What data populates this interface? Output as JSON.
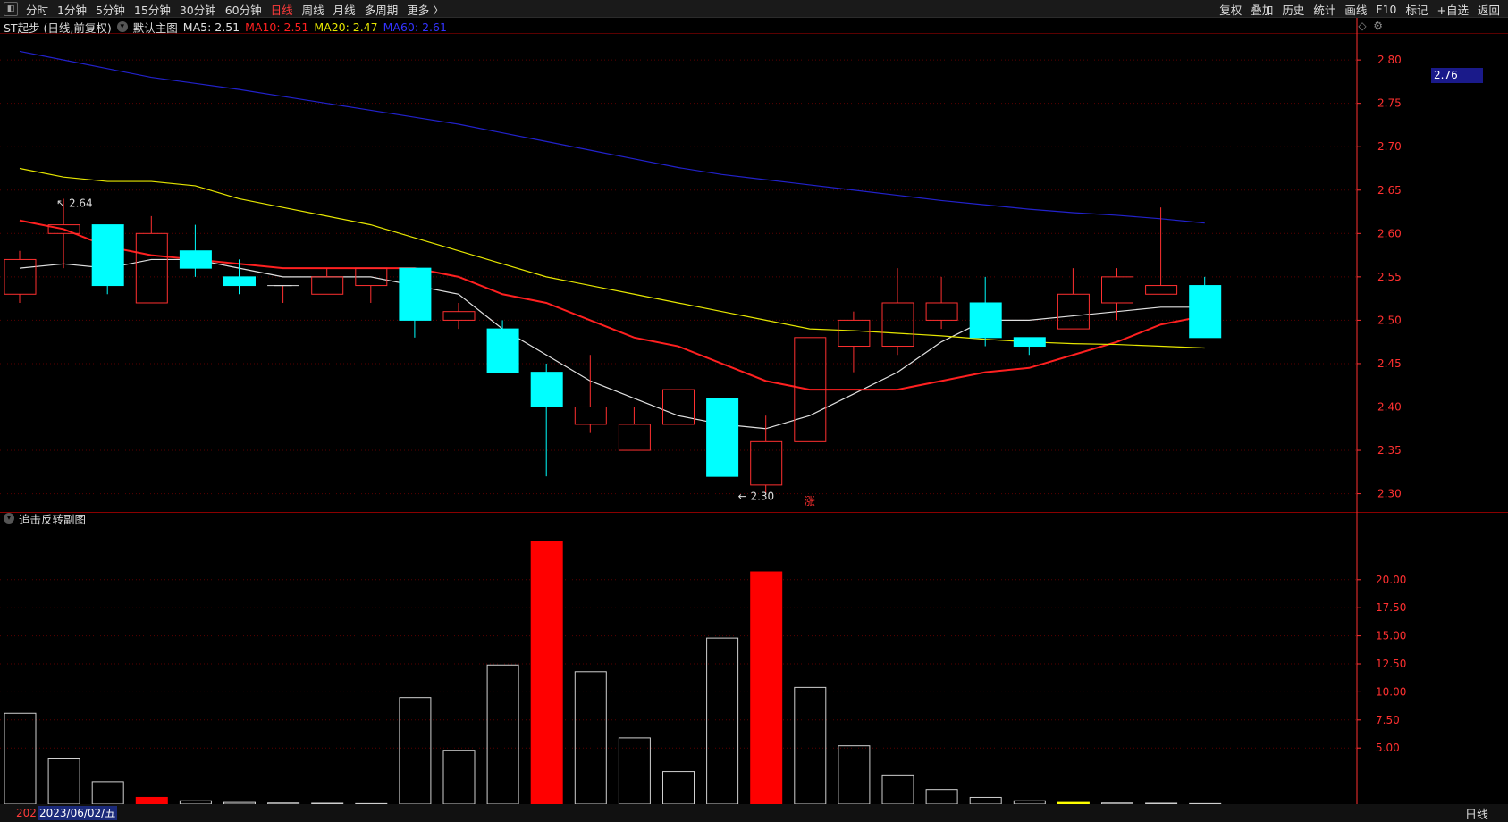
{
  "toolbar": {
    "left": [
      {
        "label": "分时",
        "active": false
      },
      {
        "label": "1分钟",
        "active": false
      },
      {
        "label": "5分钟",
        "active": false
      },
      {
        "label": "15分钟",
        "active": false
      },
      {
        "label": "30分钟",
        "active": false
      },
      {
        "label": "60分钟",
        "active": false
      },
      {
        "label": "日线",
        "active": true
      },
      {
        "label": "周线",
        "active": false
      },
      {
        "label": "月线",
        "active": false
      },
      {
        "label": "多周期",
        "active": false
      },
      {
        "label": "更多 〉",
        "active": false
      }
    ],
    "right": [
      "复权",
      "叠加",
      "历史",
      "统计",
      "画线",
      "F10",
      "标记",
      "+自选",
      "返回"
    ]
  },
  "legend": {
    "title": "ST起步 (日线,前复权)",
    "template": "默认主图",
    "ma5": "MA5: 2.51",
    "ma10": "MA10: 2.51",
    "ma20": "MA20: 2.47",
    "ma60": "MA60: 2.61"
  },
  "sub_legend": {
    "title": "追击反转副图"
  },
  "footer": {
    "prefix": "202",
    "date": "2023/06/02/五",
    "mid_marker": "7",
    "period": "日线"
  },
  "current_price": "2.76",
  "annotations": {
    "high": "2.64",
    "low": "2.30",
    "signal": "涨"
  },
  "colors": {
    "up": "#ff3030",
    "down": "#00ffff",
    "ma5": "#e0e0e0",
    "ma10": "#ff2020",
    "ma20": "#e6e600",
    "ma60": "#2222cc",
    "grid": "#5a0000",
    "axis": "#ff3030"
  },
  "chart_data": [
    {
      "type": "candlestick",
      "title": "ST起步 (日线,前复权)",
      "ylim": [
        2.28,
        2.83
      ],
      "yticks": [
        2.3,
        2.35,
        2.4,
        2.45,
        2.5,
        2.55,
        2.6,
        2.65,
        2.7,
        2.75,
        2.8
      ],
      "ohlc": [
        [
          2.53,
          2.58,
          2.52,
          2.57
        ],
        [
          2.6,
          2.64,
          2.56,
          2.61
        ],
        [
          2.61,
          2.61,
          2.53,
          2.54
        ],
        [
          2.52,
          2.62,
          2.52,
          2.6
        ],
        [
          2.58,
          2.61,
          2.55,
          2.56
        ],
        [
          2.55,
          2.57,
          2.53,
          2.54
        ],
        [
          2.54,
          2.54,
          2.52,
          2.54
        ],
        [
          2.53,
          2.56,
          2.53,
          2.55
        ],
        [
          2.54,
          2.56,
          2.52,
          2.56
        ],
        [
          2.56,
          2.56,
          2.48,
          2.5
        ],
        [
          2.5,
          2.52,
          2.49,
          2.51
        ],
        [
          2.49,
          2.5,
          2.44,
          2.44
        ],
        [
          2.44,
          2.45,
          2.32,
          2.4
        ],
        [
          2.38,
          2.46,
          2.37,
          2.4
        ],
        [
          2.35,
          2.4,
          2.35,
          2.38
        ],
        [
          2.38,
          2.44,
          2.37,
          2.42
        ],
        [
          2.41,
          2.41,
          2.32,
          2.32
        ],
        [
          2.31,
          2.39,
          2.3,
          2.36
        ],
        [
          2.36,
          2.48,
          2.36,
          2.48
        ],
        [
          2.47,
          2.51,
          2.44,
          2.5
        ],
        [
          2.47,
          2.56,
          2.46,
          2.52
        ],
        [
          2.5,
          2.55,
          2.49,
          2.52
        ],
        [
          2.52,
          2.55,
          2.47,
          2.48
        ],
        [
          2.48,
          2.48,
          2.46,
          2.47
        ],
        [
          2.49,
          2.56,
          2.49,
          2.53
        ],
        [
          2.52,
          2.56,
          2.5,
          2.55
        ],
        [
          2.53,
          2.63,
          2.53,
          2.54
        ],
        [
          2.54,
          2.55,
          2.48,
          2.48
        ]
      ],
      "series": [
        {
          "name": "MA5",
          "values": [
            2.56,
            2.565,
            2.56,
            2.57,
            2.57,
            2.56,
            2.55,
            2.55,
            2.55,
            2.54,
            2.53,
            2.49,
            2.46,
            2.43,
            2.41,
            2.39,
            2.38,
            2.375,
            2.39,
            2.415,
            2.44,
            2.475,
            2.5,
            2.5,
            2.505,
            2.51,
            2.515,
            2.515
          ]
        },
        {
          "name": "MA10",
          "values": [
            2.615,
            2.605,
            2.585,
            2.575,
            2.57,
            2.565,
            2.56,
            2.56,
            2.56,
            2.56,
            2.55,
            2.53,
            2.52,
            2.5,
            2.48,
            2.47,
            2.45,
            2.43,
            2.42,
            2.42,
            2.42,
            2.43,
            2.44,
            2.445,
            2.46,
            2.475,
            2.495,
            2.505
          ]
        },
        {
          "name": "MA20",
          "values": [
            2.675,
            2.665,
            2.66,
            2.66,
            2.655,
            2.64,
            2.63,
            2.62,
            2.61,
            2.595,
            2.58,
            2.565,
            2.55,
            2.54,
            2.53,
            2.52,
            2.51,
            2.5,
            2.49,
            2.488,
            2.485,
            2.482,
            2.478,
            2.475,
            2.473,
            2.472,
            2.47,
            2.468
          ]
        },
        {
          "name": "MA60",
          "values": [
            2.81,
            2.8,
            2.79,
            2.78,
            2.773,
            2.766,
            2.758,
            2.75,
            2.742,
            2.734,
            2.726,
            2.716,
            2.706,
            2.696,
            2.686,
            2.676,
            2.668,
            2.662,
            2.656,
            2.65,
            2.644,
            2.638,
            2.633,
            2.628,
            2.624,
            2.621,
            2.617,
            2.612
          ]
        }
      ]
    },
    {
      "type": "bar",
      "title": "追击反转副图",
      "ylim": [
        0,
        25
      ],
      "yticks": [
        5.0,
        7.5,
        10.0,
        12.5,
        15.0,
        17.5,
        20.0
      ],
      "values": [
        8.1,
        4.1,
        2.0,
        0.6,
        0.3,
        0.15,
        0.1,
        0.08,
        0.05,
        9.5,
        4.8,
        12.4,
        23.4,
        11.8,
        5.9,
        2.9,
        14.8,
        20.7,
        10.4,
        5.2,
        2.6,
        1.3,
        0.6,
        0.3,
        0.15,
        0.1,
        0.08,
        0.05
      ],
      "highlight": {
        "red": [
          3,
          12,
          17
        ],
        "yellow": [
          24
        ]
      }
    }
  ]
}
